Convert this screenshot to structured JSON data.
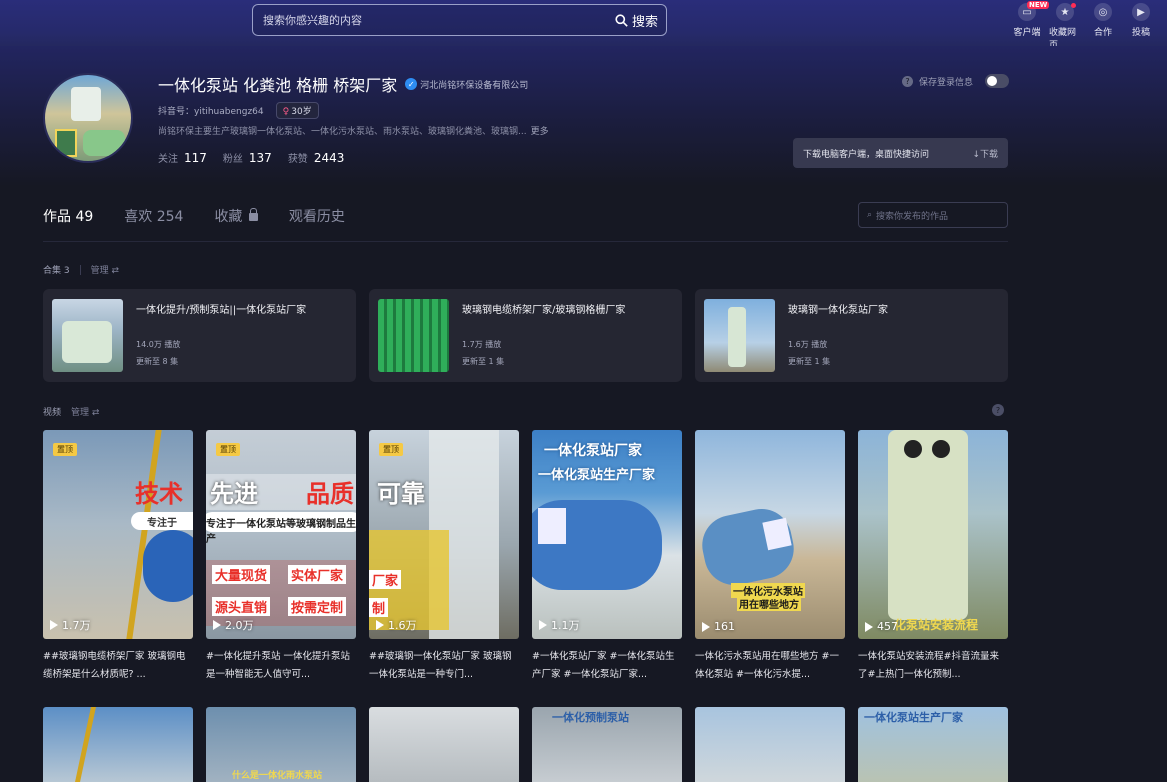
{
  "topbar": {
    "search_placeholder": "搜索你感兴趣的内容",
    "search_button": "搜索",
    "actions": [
      {
        "label": "客户端",
        "icon": "desktop-icon",
        "badge": "NEW"
      },
      {
        "label": "收藏网页",
        "icon": "star-icon"
      },
      {
        "label": "合作",
        "icon": "handshake-icon"
      },
      {
        "label": "投稿",
        "icon": "upload-icon"
      }
    ]
  },
  "profile": {
    "name": "一体化泵站 化粪池 格栅 桥架厂家",
    "verified_label": "河北尚铭环保设备有限公司",
    "douyin_id": "抖音号：yitihuabengz64",
    "age": "30岁",
    "bio": "尚铭环保主要生产玻璃钢一体化泵站、一体化污水泵站、雨水泵站、玻璃钢化粪池、玻璃钢...",
    "bio_more": "更多",
    "stats": [
      {
        "label": "关注",
        "value": "117"
      },
      {
        "label": "粉丝",
        "value": "137"
      },
      {
        "label": "获赞",
        "value": "2443"
      }
    ],
    "save_login_label": "保存登录信息",
    "download_text": "下载电脑客户端，桌面快捷访问",
    "download_button": "↓下载"
  },
  "tabs": [
    {
      "label": "作品 49",
      "active": true
    },
    {
      "label": "喜欢 254"
    },
    {
      "label": "收藏"
    },
    {
      "label": "观看历史"
    }
  ],
  "work_search_placeholder": "搜索你发布的作品",
  "collections": {
    "header": "合集 3",
    "manage": "管理",
    "items": [
      {
        "title": "一体化提升/预制泵站||一体化泵站厂家",
        "plays": "14.0万 播放",
        "update": "更新至 8 集"
      },
      {
        "title": "玻璃钢电缆桥架厂家/玻璃钢格栅厂家",
        "plays": "1.7万 播放",
        "update": "更新至 1 集"
      },
      {
        "title": "玻璃钢一体化泵站厂家",
        "plays": "1.6万 播放",
        "update": "更新至 1 集"
      }
    ]
  },
  "videos": {
    "header": "视频",
    "manage": "管理",
    "pin_label": "置顶",
    "items": [
      {
        "plays": "1.7万",
        "caption": "##玻璃钢电缆桥架厂家 玻璃钢电缆桥架是什么材质呢? ...",
        "pinned": true
      },
      {
        "plays": "2.0万",
        "caption": "#一体化提升泵站 一体化提升泵站是一种智能无人值守可...",
        "pinned": true
      },
      {
        "plays": "1.6万",
        "caption": "##玻璃钢一体化泵站厂家 玻璃钢一体化泵站是一种专门...",
        "pinned": true
      },
      {
        "plays": "1.1万",
        "caption": "#一体化泵站厂家 #一体化泵站生产厂家 #一体化泵站厂家..."
      },
      {
        "plays": "161",
        "caption": "一体化污水泵站用在哪些地方 #一体化泵站 #一体化污水提..."
      },
      {
        "plays": "457",
        "caption": "一体化泵站安装流程#抖音流量来了#上热门一体化预制..."
      }
    ],
    "overlay": {
      "banner_left": "技术",
      "banner_mid": "先进",
      "banner_mid2": "品质",
      "banner_right": "可靠",
      "sub_strip": "专注于一体化泵站等玻璃钢制品生产",
      "chip1": "大量现货",
      "chip2": "实体厂家",
      "chip3": "源头直销",
      "chip4": "按需定制",
      "v4_title1": "一体化泵站厂家",
      "v4_title2": "一体化泵站生产厂家",
      "v5_text1": "一体化污水泵站",
      "v5_text2": "用在哪些地方",
      "v6_text": "化泵站安装流程",
      "row2_v2": "什么是一体化雨水泵站",
      "row2_v4": "一体化预制泵站",
      "row2_v6": "一体化泵站生产厂家"
    }
  }
}
